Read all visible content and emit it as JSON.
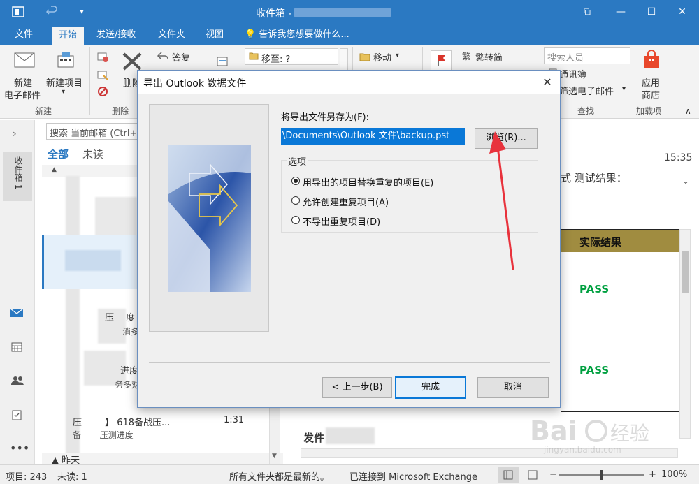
{
  "titlebar": {
    "title": "收件箱 -",
    "min": "—",
    "max": "☐",
    "close": "✕",
    "restore": "⧉"
  },
  "menu": {
    "items": [
      "文件",
      "开始",
      "发送/接收",
      "文件夹",
      "视图"
    ],
    "tell_me": "告诉我您想要做什么..."
  },
  "ribbon": {
    "new_email": "新建\n电子邮件",
    "new_email_l1": "新建",
    "new_email_l2": "电子邮件",
    "new_items": "新建项目",
    "new_items_arrow": "▾",
    "group_new": "新建",
    "delete": "删除",
    "group_delete": "删除",
    "reply": "答复",
    "move_to": "移至: ?",
    "move": "移动",
    "trad_to_simp": "繁转简",
    "search_people_placeholder": "搜索人员",
    "address_book": "通讯簿",
    "filter_email": "筛选电子邮件",
    "group_find": "查找",
    "store_l1": "应用",
    "store_l2": "商店",
    "group_addins": "加载项"
  },
  "mail_list": {
    "search_placeholder": "搜索 当前邮箱 (Ctrl+",
    "tab_all": "全部",
    "tab_unread": "未读",
    "group_today": "▲",
    "item_subject_partial": "压",
    "item_label_1": "度",
    "item_label_2": "进度",
    "item_label_3": "消多",
    "item_label_4": "务多对",
    "last_item_title": "压        】 618备战压...",
    "last_item_time": "1:31",
    "last_item_sub": "备       压测进度",
    "group_yesterday": "▲ 昨天",
    "folder_label": "收件箱 1"
  },
  "reading": {
    "time": "15:35",
    "subject_tail": "式  测试结果：",
    "col_header": "实际结果",
    "pass1": "PASS",
    "pass2": "PASS",
    "sender_label": "发件"
  },
  "status": {
    "items": "项目: 243",
    "unread": "未读: 1",
    "folders": "所有文件夹都是最新的。",
    "connected": "已连接到 Microsoft Exchange",
    "zoom": "100%",
    "zoom_minus": "−",
    "zoom_plus": "+"
  },
  "dialog": {
    "title": "导出 Outlook 数据文件",
    "close": "✕",
    "save_as_label": "将导出文件另存为(F):",
    "path_value": "\\Documents\\Outlook 文件\\backup.pst",
    "browse": "浏览(R)...",
    "options_label": "选项",
    "opt1": "用导出的项目替换重复的项目(E)",
    "opt2": "允许创建重复项目(A)",
    "opt3": "不导出重复项目(D)",
    "back": "< 上一步(B)",
    "finish": "完成",
    "cancel": "取消"
  },
  "colors": {
    "accent": "#2b79c2",
    "selection": "#0a78d7",
    "pass": "#00a040",
    "table_header": "#a08c40",
    "arrow": "#e8323c"
  }
}
